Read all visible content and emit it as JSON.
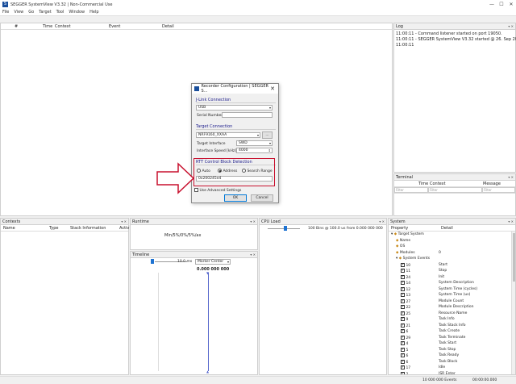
{
  "window": {
    "title": "SEGGER SystemView V3.32 | Non-Commercial Use",
    "controls": [
      "—",
      "☐",
      "✕"
    ]
  },
  "menu": [
    "File",
    "View",
    "Go",
    "Target",
    "Tool",
    "Window",
    "Help"
  ],
  "events_panel": {
    "columns": [
      "#",
      "Time",
      "Context",
      "Event",
      "Detail"
    ]
  },
  "log_panel": {
    "title": "Log",
    "lines": [
      "11:00:11 - Command listener started on port 19050.",
      "11:00:11 - SEGGER SystemView V3.32 started @ 26. Sep 2022",
      "11:00:11"
    ]
  },
  "terminal_panel": {
    "title": "Terminal",
    "columns": [
      "Time",
      "Context",
      "Message"
    ],
    "filter_placeholder": "Filter"
  },
  "contexts_panel": {
    "title": "Contexts",
    "columns": [
      "Name",
      "Type",
      "Stack Information",
      "Activ"
    ]
  },
  "runtime_panel": {
    "title": "Runtime",
    "content": "Min/5%/0%/5%/ax"
  },
  "timeline_panel": {
    "title": "Timeline",
    "zoom": "10.0 ms",
    "marker_mode": "Marker Center",
    "time_readout": "0.000 000 000"
  },
  "cpu_panel": {
    "title": "CPU Load",
    "readout": "100 Bins @ 100.0 us from 0.000 000 000"
  },
  "system_panel": {
    "title": "System",
    "columns": [
      "Property",
      "Detail"
    ],
    "rows": [
      {
        "prop": "Target System",
        "val": "",
        "indent": 0,
        "type": "group"
      },
      {
        "prop": "Name",
        "val": "",
        "indent": 1,
        "type": "item"
      },
      {
        "prop": "OS",
        "val": "",
        "indent": 1,
        "type": "item"
      },
      {
        "prop": "Modules",
        "val": "0",
        "indent": 1,
        "type": "item"
      },
      {
        "prop": "System Events",
        "val": "",
        "indent": 1,
        "type": "group"
      },
      {
        "prop": "10",
        "val": "Start",
        "indent": 2,
        "type": "check"
      },
      {
        "prop": "11",
        "val": "Stop",
        "indent": 2,
        "type": "check"
      },
      {
        "prop": "24",
        "val": "Init",
        "indent": 2,
        "type": "check"
      },
      {
        "prop": "14",
        "val": "System Description",
        "indent": 2,
        "type": "check"
      },
      {
        "prop": "12",
        "val": "System Time (cycles)",
        "indent": 2,
        "type": "check"
      },
      {
        "prop": "13",
        "val": "System Time (us)",
        "indent": 2,
        "type": "check"
      },
      {
        "prop": "27",
        "val": "Module Count",
        "indent": 2,
        "type": "check"
      },
      {
        "prop": "22",
        "val": "Module Description",
        "indent": 2,
        "type": "check"
      },
      {
        "prop": "25",
        "val": "Resource Name",
        "indent": 2,
        "type": "check"
      },
      {
        "prop": "9",
        "val": "Task Info",
        "indent": 2,
        "type": "check"
      },
      {
        "prop": "21",
        "val": "Task Stack Info",
        "indent": 2,
        "type": "check"
      },
      {
        "prop": "6",
        "val": "Task Create",
        "indent": 2,
        "type": "check"
      },
      {
        "prop": "29",
        "val": "Task Terminate",
        "indent": 2,
        "type": "check"
      },
      {
        "prop": "4",
        "val": "Task Start",
        "indent": 2,
        "type": "check"
      },
      {
        "prop": "5",
        "val": "Task Stop",
        "indent": 2,
        "type": "check"
      },
      {
        "prop": "6",
        "val": "Task Ready",
        "indent": 2,
        "type": "check"
      },
      {
        "prop": "6",
        "val": "Task Block",
        "indent": 2,
        "type": "check"
      },
      {
        "prop": "17",
        "val": "Idle",
        "indent": 2,
        "type": "check"
      },
      {
        "prop": "2",
        "val": "ISR Enter",
        "indent": 2,
        "type": "check"
      }
    ]
  },
  "status_bar": {
    "events": "10 000 000 Events",
    "time": "00:00:00.000"
  },
  "dialog": {
    "title": "Recorder Configuration | SEGGER S...",
    "jlink_group": "J-Link Connection",
    "connection_type": "USB",
    "serial_label": "Serial Number",
    "serial_value": "",
    "target_group": "Target Connection",
    "device": "NRF9160_XXAA",
    "browse_label": "...",
    "interface_label": "Target Interface",
    "interface_value": "SWD",
    "speed_label": "Interface Speed [kHz]",
    "speed_value": "4000",
    "rtt_group": "RTT Control Block Detection",
    "radio_auto": "Auto",
    "radio_address": "Address",
    "radio_search": "Search Range",
    "address_value": "0x200245e4",
    "advanced_label": "Use Advanced Settings",
    "ok_label": "OK",
    "cancel_label": "Cancel"
  },
  "colors": {
    "highlight": "#c8102e",
    "accent": "#0078d7"
  }
}
